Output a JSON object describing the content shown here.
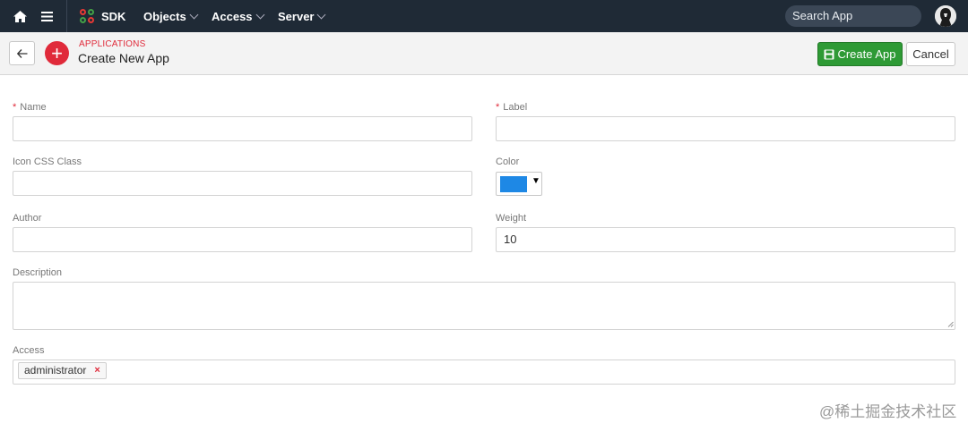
{
  "navbar": {
    "menus": [
      "SDK",
      "Objects",
      "Access",
      "Server"
    ],
    "search_placeholder": "Search App"
  },
  "header": {
    "eyebrow": "APPLICATIONS",
    "title": "Create New App",
    "create_label": "Create App",
    "cancel_label": "Cancel"
  },
  "form": {
    "name_label": "Name",
    "name_value": "",
    "label_label": "Label",
    "label_value": "",
    "icon_label": "Icon CSS Class",
    "icon_value": "",
    "color_label": "Color",
    "color_value": "#1e88e5",
    "author_label": "Author",
    "author_value": "",
    "weight_label": "Weight",
    "weight_value": "10",
    "description_label": "Description",
    "description_value": "",
    "access_label": "Access",
    "access_tags": [
      "administrator"
    ],
    "required_mark": "*"
  },
  "colors": {
    "navbar": "#1f2a36",
    "accent_red": "#e02a3a",
    "create_green": "#2e9a35"
  },
  "watermark": "@稀土掘金技术社区"
}
